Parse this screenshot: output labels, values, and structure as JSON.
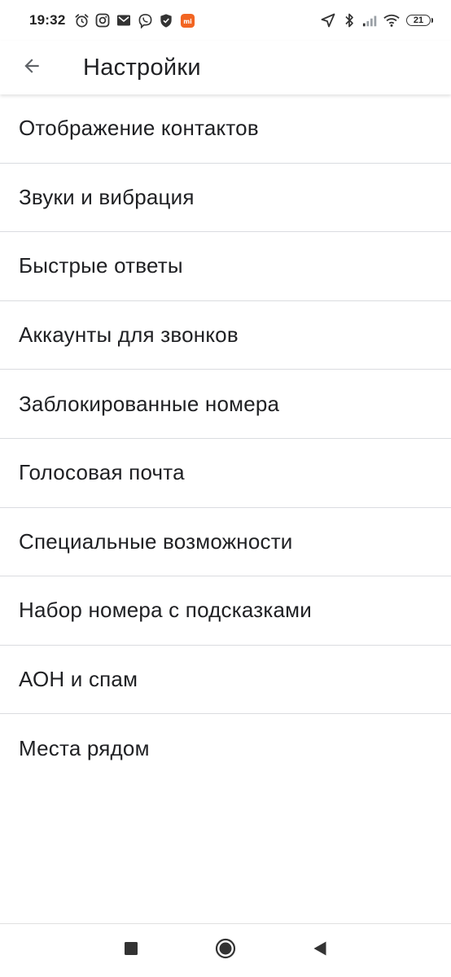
{
  "status_bar": {
    "time": "19:32",
    "battery_level": "21",
    "notification_icons": [
      "alarm-icon",
      "instagram-icon",
      "mail-icon",
      "viber-icon",
      "shield-icon",
      "mi-app-icon"
    ],
    "system_icons": [
      "location-icon",
      "bluetooth-icon",
      "signal-icon",
      "wifi-icon",
      "battery-icon"
    ],
    "accent_color": "#f26522"
  },
  "app_bar": {
    "title": "Настройки",
    "back_icon": "arrow-back-icon"
  },
  "settings": {
    "items": [
      {
        "label": "Отображение контактов"
      },
      {
        "label": "Звуки и вибрация"
      },
      {
        "label": "Быстрые ответы"
      },
      {
        "label": "Аккаунты для звонков"
      },
      {
        "label": "Заблокированные номера"
      },
      {
        "label": "Голосовая почта"
      },
      {
        "label": "Специальные возможности"
      },
      {
        "label": "Набор номера с подсказками"
      },
      {
        "label": "АОН и спам"
      },
      {
        "label": "Места рядом"
      }
    ]
  },
  "nav_bar": {
    "buttons": [
      "recents-square-icon",
      "home-circle-icon",
      "back-triangle-icon"
    ]
  }
}
